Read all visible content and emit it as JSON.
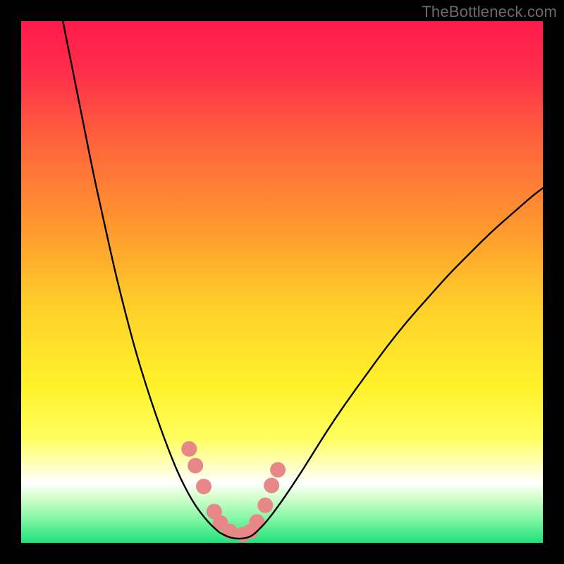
{
  "watermark": "TheBottleneck.com",
  "chart_data": {
    "type": "line",
    "title": "",
    "xlabel": "",
    "ylabel": "",
    "xlim": [
      0,
      100
    ],
    "ylim": [
      0,
      100
    ],
    "grid": false,
    "legend": false,
    "background_gradient_stops": [
      {
        "offset": 0.0,
        "color": "#ff1a4b"
      },
      {
        "offset": 0.1,
        "color": "#ff2f4a"
      },
      {
        "offset": 0.25,
        "color": "#ff6a3a"
      },
      {
        "offset": 0.4,
        "color": "#ff9a2e"
      },
      {
        "offset": 0.55,
        "color": "#ffd02a"
      },
      {
        "offset": 0.7,
        "color": "#fff22a"
      },
      {
        "offset": 0.8,
        "color": "#ffff60"
      },
      {
        "offset": 0.86,
        "color": "#ffffd0"
      },
      {
        "offset": 0.885,
        "color": "#ffffff"
      },
      {
        "offset": 0.91,
        "color": "#d8ffd0"
      },
      {
        "offset": 0.95,
        "color": "#8cf7a8"
      },
      {
        "offset": 1.0,
        "color": "#1fe27a"
      }
    ],
    "series": [
      {
        "name": "left-curve",
        "color": "#000000",
        "width": 2.4,
        "x": [
          8,
          10,
          12,
          14,
          16,
          18,
          20,
          22,
          24,
          26,
          28,
          30,
          32,
          33.5,
          35,
          36.5,
          38
        ],
        "y": [
          100,
          90,
          80,
          70,
          61,
          52,
          44,
          36.5,
          30,
          24,
          18.5,
          13.5,
          9.5,
          7,
          5,
          3.3,
          2
        ]
      },
      {
        "name": "right-curve",
        "color": "#000000",
        "width": 2.4,
        "x": [
          45,
          47,
          50,
          54,
          58,
          62,
          66,
          70,
          74,
          78,
          82,
          86,
          90,
          94,
          98,
          100
        ],
        "y": [
          2,
          4,
          8,
          14,
          20.5,
          26.5,
          32,
          37.5,
          42.5,
          47,
          51.5,
          55.5,
          59.5,
          63,
          66.5,
          68
        ]
      },
      {
        "name": "valley-floor",
        "color": "#000000",
        "width": 2.4,
        "x": [
          38,
          39.5,
          41,
          42.5,
          44,
          45
        ],
        "y": [
          2,
          1.2,
          0.8,
          0.8,
          1.2,
          2
        ]
      }
    ],
    "markers": {
      "name": "highlighted-points",
      "color": "#e88787",
      "radius": 11,
      "points": [
        {
          "x": 32.2,
          "y": 18.0
        },
        {
          "x": 33.4,
          "y": 14.8
        },
        {
          "x": 35.0,
          "y": 10.8
        },
        {
          "x": 37.0,
          "y": 6.0
        },
        {
          "x": 38.2,
          "y": 3.8
        },
        {
          "x": 40.0,
          "y": 2.2
        },
        {
          "x": 42.5,
          "y": 1.6
        },
        {
          "x": 44.0,
          "y": 2.2
        },
        {
          "x": 45.2,
          "y": 4.0
        },
        {
          "x": 46.8,
          "y": 7.2
        },
        {
          "x": 48.0,
          "y": 11.0
        },
        {
          "x": 49.2,
          "y": 14.0
        }
      ]
    }
  }
}
